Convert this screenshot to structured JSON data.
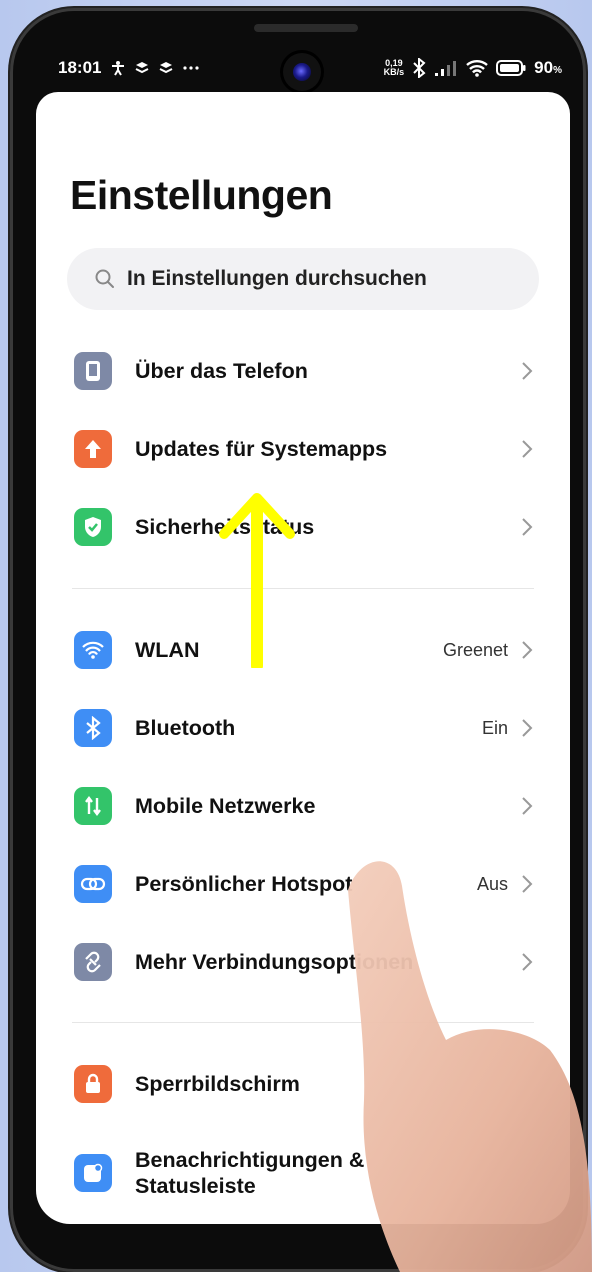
{
  "statusbar": {
    "time": "18:01",
    "speed_value": "0,19",
    "speed_unit": "KB/s",
    "battery": "90",
    "battery_unit": "%",
    "left_icons": [
      "person-icon",
      "layers-icon",
      "layers-icon",
      "more-dots-icon"
    ],
    "right_icons": [
      "bluetooth-icon",
      "signal-icon",
      "wifi-icon",
      "battery-icon"
    ]
  },
  "settings": {
    "title": "Einstellungen",
    "search_placeholder": "In Einstellungen durchsuchen",
    "groups": [
      [
        {
          "label": "Über das Telefon",
          "value": "",
          "icon": "phone-icon",
          "color": "#7e89a6"
        },
        {
          "label": "Updates für Systemapps",
          "value": "",
          "icon": "arrow-up-icon",
          "color": "#ef6b3b"
        },
        {
          "label": "Sicherheitsstatus",
          "value": "",
          "icon": "shield-check-icon",
          "color": "#33c46a"
        }
      ],
      [
        {
          "label": "WLAN",
          "value": "Greenet",
          "icon": "wifi-icon",
          "color": "#3f8ef5"
        },
        {
          "label": "Bluetooth",
          "value": "Ein",
          "icon": "bluetooth-icon",
          "color": "#3f8ef5"
        },
        {
          "label": "Mobile Netzwerke",
          "value": "",
          "icon": "mobile-data-icon",
          "color": "#33c46a"
        },
        {
          "label": "Persönlicher Hotspot",
          "value": "Aus",
          "icon": "hotspot-link-icon",
          "color": "#3f8ef5"
        },
        {
          "label": "Mehr Verbindungsoptionen",
          "value": "",
          "icon": "connection-icon",
          "color": "#7e89a6"
        }
      ],
      [
        {
          "label": "Sperrbildschirm",
          "value": "",
          "icon": "lock-icon",
          "color": "#ef6b3b"
        },
        {
          "label": "Benachrichtigungen & Statusleiste",
          "value": "",
          "icon": "notification-icon",
          "color": "#3f8ef5"
        }
      ]
    ]
  },
  "overlay": {
    "gesture_color": "#ffff00"
  }
}
